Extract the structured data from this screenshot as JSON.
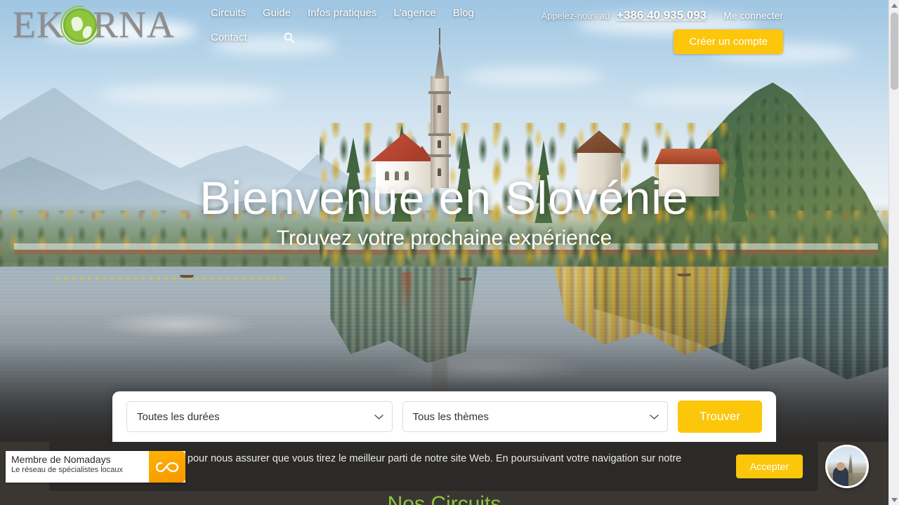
{
  "brand": {
    "name": "EKORNA",
    "logo_icon": "globe-icon",
    "accent_yellow": "#fcc60b",
    "accent_green": "#8cc63f",
    "logo_text_color": "#8e8e8e"
  },
  "header": {
    "nav_primary": [
      {
        "label": "Circuits"
      },
      {
        "label": "Guide"
      },
      {
        "label": "Infos pratiques"
      },
      {
        "label": "L'agence"
      },
      {
        "label": "Blog"
      }
    ],
    "nav_secondary": [
      {
        "label": "Contact"
      }
    ],
    "search_icon": "search-icon",
    "call_label": "Appelez-nous au",
    "phone": "+386 40 935 093",
    "login_label": "Me connecter",
    "create_account_label": "Créer un compte"
  },
  "hero": {
    "title": "Bienvenue en Slovénie",
    "subtitle": "Trouvez votre prochaine expérience",
    "image_description": "Lake Bled, Slovenia"
  },
  "search_panel": {
    "duration_select": {
      "value": "Toutes les durées",
      "icon": "chevron-down-icon"
    },
    "theme_select": {
      "value": "Tous les thèmes",
      "icon": "chevron-down-icon"
    },
    "submit_label": "Trouver"
  },
  "next_section": {
    "title_peek": "Nos Circuits"
  },
  "nomadays_badge": {
    "title": "Membre de Nomadays",
    "subtitle": "Le réseau de spécialistes locaux",
    "logo_icon": "infinity-icon"
  },
  "cookie_banner": {
    "text": "Nous utilisons des cookies pour nous assurer que vous tirez le meilleur parti de notre site Web. En poursuivant votre navigation sur notre utilisation des cookies",
    "accept_label": "Accepter"
  },
  "chat_widget": {
    "avatar_alt": "Conseiller",
    "avatar_icon": "person-avatar"
  },
  "scrollbar": {
    "up_icon": "triangle-up-icon",
    "down_icon": "triangle-down-icon"
  }
}
